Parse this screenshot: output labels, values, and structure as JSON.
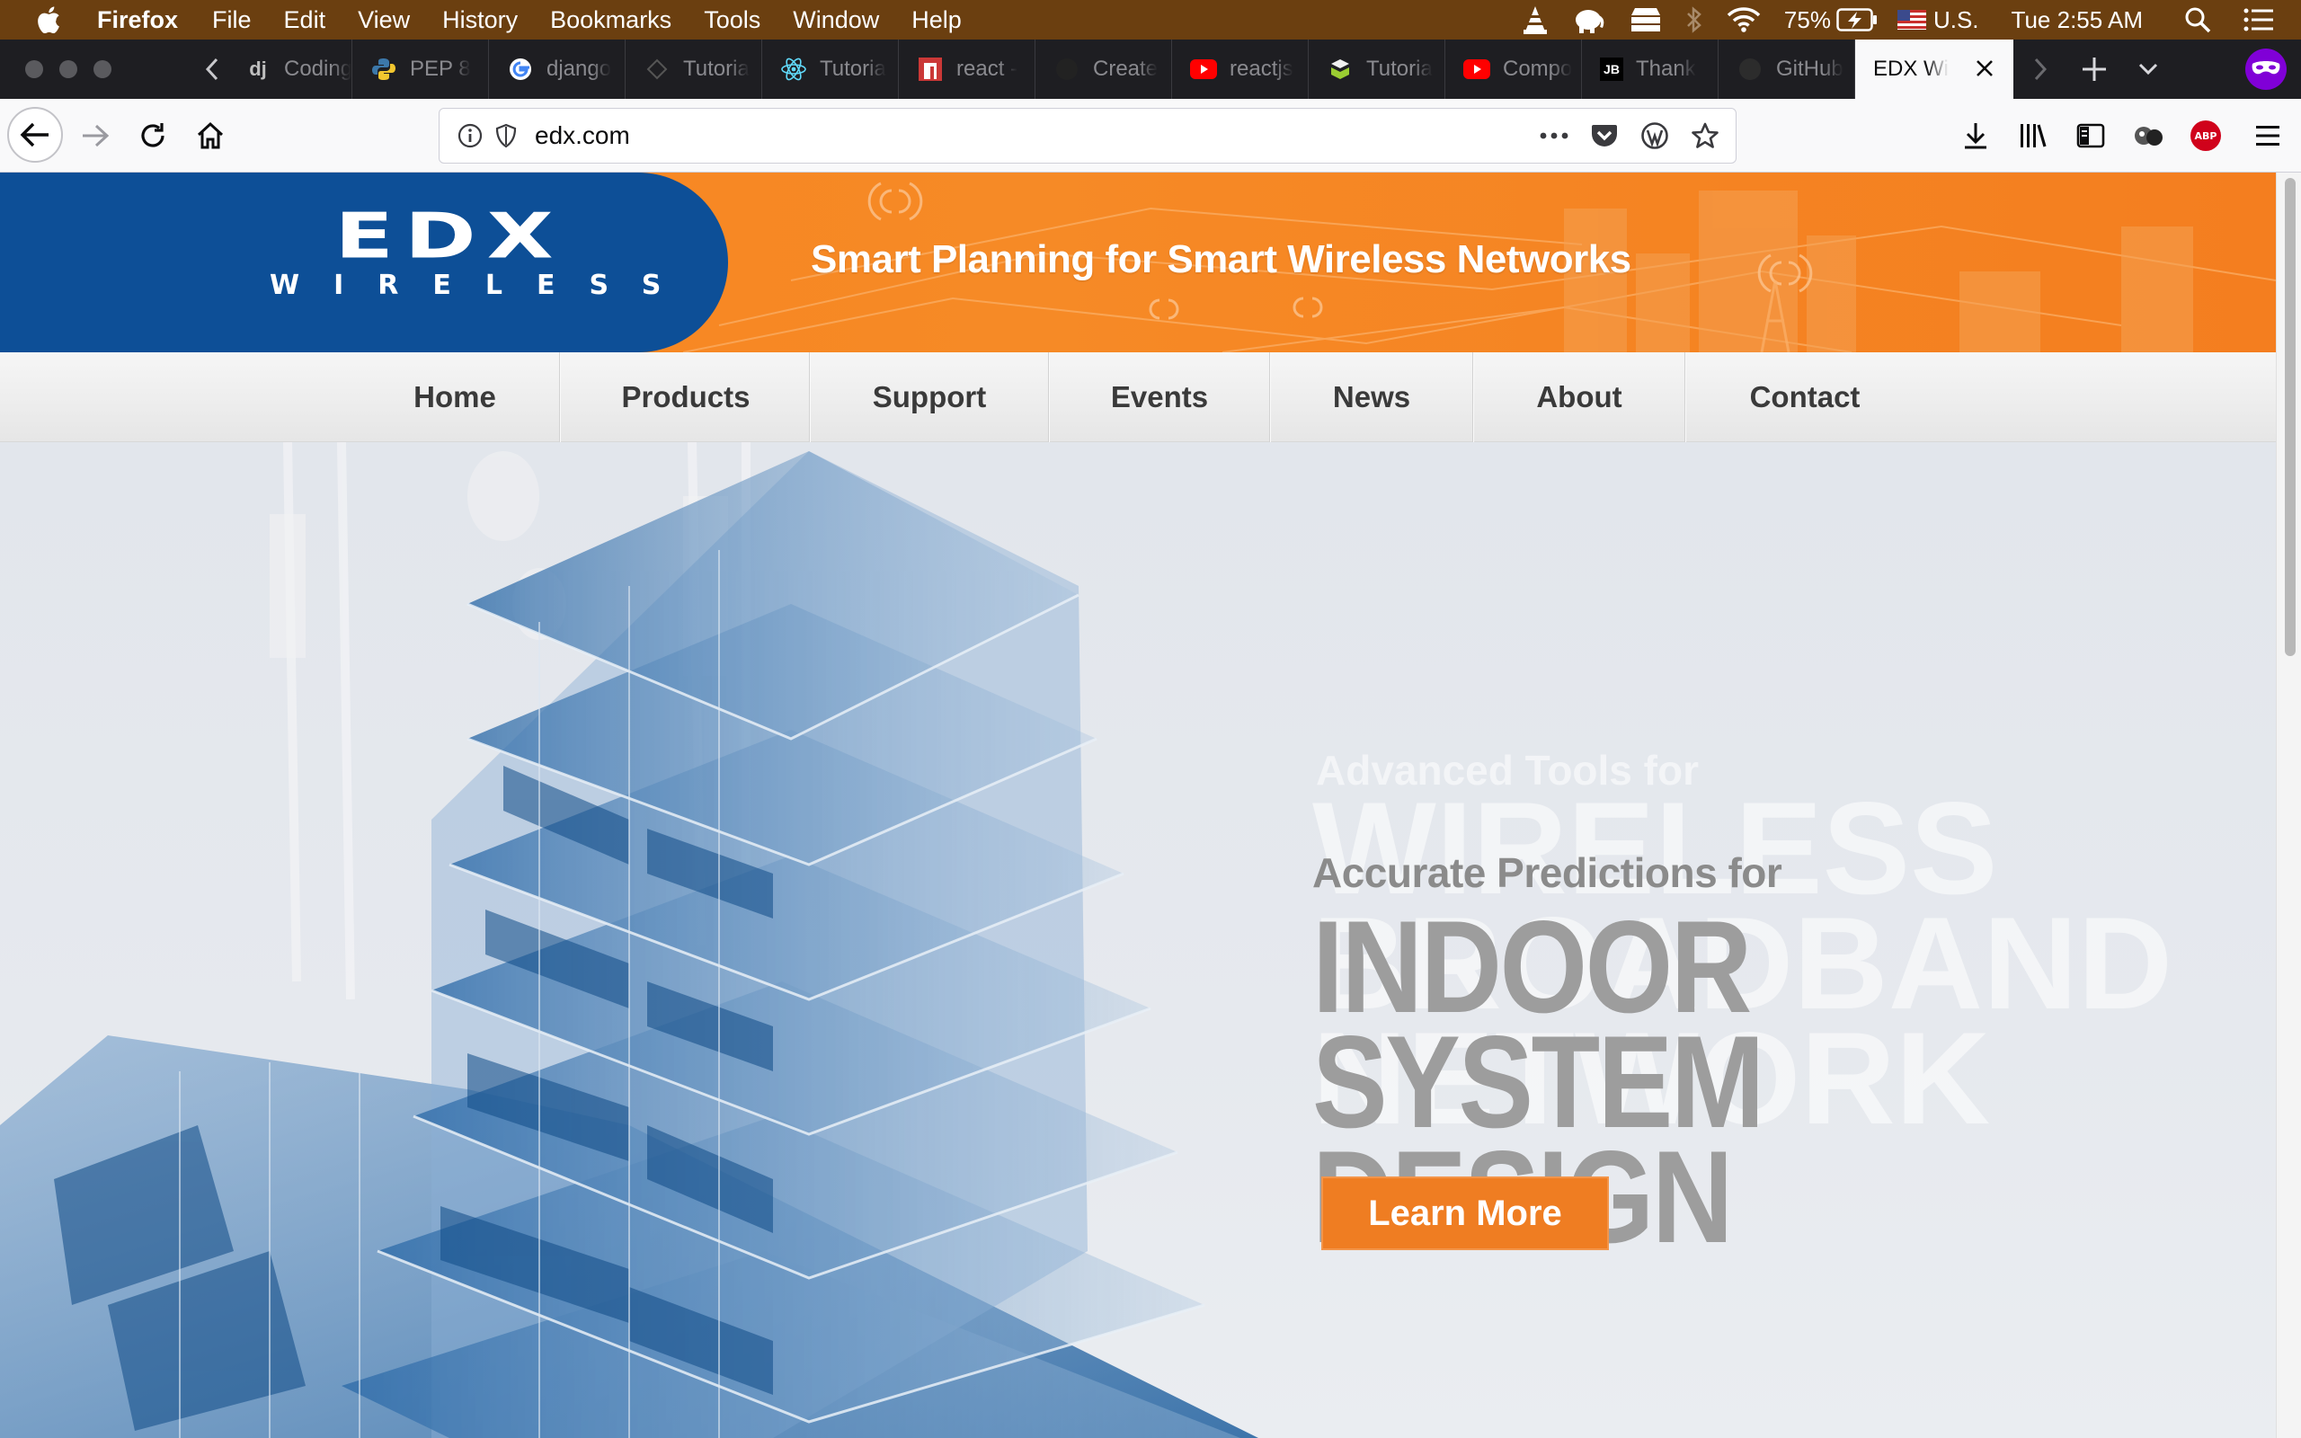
{
  "menubar": {
    "app_name": "Firefox",
    "items": [
      "File",
      "Edit",
      "View",
      "History",
      "Bookmarks",
      "Tools",
      "Window",
      "Help"
    ],
    "battery": "75%",
    "input_source": "U.S.",
    "clock": "Tue 2:55 AM"
  },
  "tabs": [
    {
      "title": "Coding",
      "icon": "django-dj-icon"
    },
    {
      "title": "PEP 8",
      "icon": "python-icon"
    },
    {
      "title": "django",
      "icon": "google-icon"
    },
    {
      "title": "Tutoria",
      "icon": "generic-site-icon"
    },
    {
      "title": "Tutoria",
      "icon": "react-icon"
    },
    {
      "title": "react -",
      "icon": "npm-icon"
    },
    {
      "title": "Create",
      "icon": "github-icon"
    },
    {
      "title": "reactjs",
      "icon": "youtube-icon"
    },
    {
      "title": "Tutoria",
      "icon": "codecademy-icon"
    },
    {
      "title": "Compo",
      "icon": "youtube-icon"
    },
    {
      "title": "Thank",
      "icon": "jetbrains-icon"
    },
    {
      "title": "GitHub",
      "icon": "github-icon"
    }
  ],
  "active_tab": {
    "title": "EDX Wi"
  },
  "address_bar": {
    "url": "edx.com"
  },
  "site": {
    "logo_main": "EDX",
    "logo_sub": "WIRELESS",
    "tagline": "Smart Planning for Smart Wireless Networks",
    "nav": [
      "Home",
      "Products",
      "Support",
      "Events",
      "News",
      "About",
      "Contact"
    ],
    "hero": {
      "ghost_sub": "Advanced Tools for",
      "ghost_line1": "WIRELESS",
      "ghost_line2": "BROADBAND",
      "ghost_line3": "NETWORK",
      "subtitle": "Accurate Predictions for",
      "line1": "INDOOR",
      "line2": "SYSTEM",
      "line3": "DESIGN",
      "cta": "Learn More"
    }
  },
  "colors": {
    "menubar_bg": "#6b3f10",
    "banner_orange": "#f68a26",
    "logo_blue": "#0d4f97",
    "cta_orange": "#ef7d22"
  }
}
